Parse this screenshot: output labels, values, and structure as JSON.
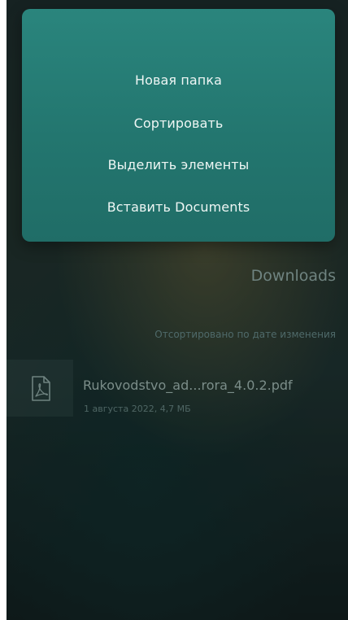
{
  "context_menu": {
    "items": [
      {
        "label": "Новая папка"
      },
      {
        "label": "Сортировать"
      },
      {
        "label": "Выделить элементы"
      },
      {
        "label": "Вставить Documents"
      }
    ]
  },
  "folder": {
    "title": "Downloads",
    "sort_label": "Отсортировано по дате изменения"
  },
  "files": [
    {
      "icon": "pdf-file-icon",
      "name": "Rukovodstvo_ad...rora_4.0.2.pdf",
      "meta": "1 августа 2022, 4,7 МБ"
    }
  ],
  "colors": {
    "menu_background": "#23766f",
    "menu_text": "#eef6f4",
    "background_dark": "#182626"
  }
}
